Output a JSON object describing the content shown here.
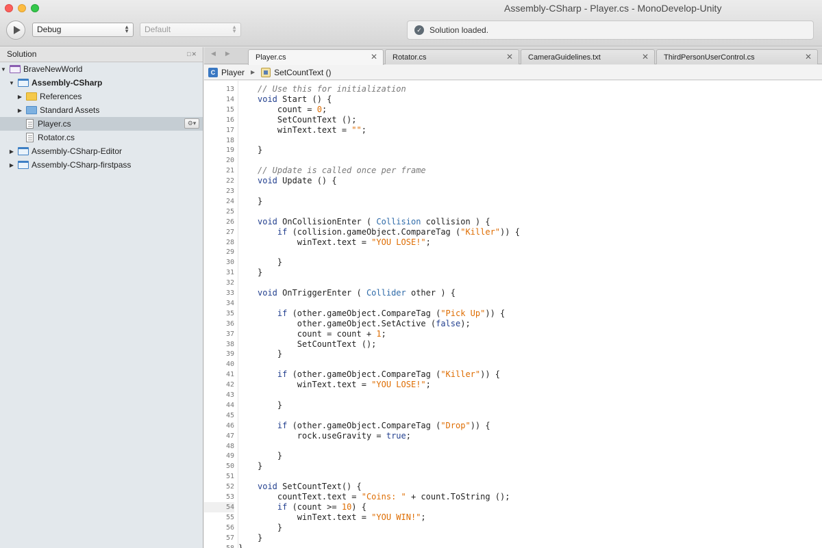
{
  "window": {
    "title": "Assembly-CSharp - Player.cs - MonoDevelop-Unity"
  },
  "toolbar": {
    "config": "Debug",
    "platform": "Default",
    "status": "Solution loaded."
  },
  "solution": {
    "title": "Solution",
    "items": [
      {
        "label": "BraveNewWorld",
        "level": 0,
        "icon": "solution",
        "expanded": true
      },
      {
        "label": "Assembly-CSharp",
        "level": 1,
        "icon": "project",
        "expanded": true,
        "bold": true
      },
      {
        "label": "References",
        "level": 2,
        "icon": "folder",
        "expanded": false
      },
      {
        "label": "Standard Assets",
        "level": 2,
        "icon": "folder-blue",
        "expanded": false
      },
      {
        "label": "Player.cs",
        "level": 2,
        "icon": "file",
        "selected": true
      },
      {
        "label": "Rotator.cs",
        "level": 2,
        "icon": "file"
      },
      {
        "label": "Assembly-CSharp-Editor",
        "level": 1,
        "icon": "project",
        "expanded": false
      },
      {
        "label": "Assembly-CSharp-firstpass",
        "level": 1,
        "icon": "project",
        "expanded": false
      }
    ]
  },
  "tabs": [
    {
      "label": "Player.cs",
      "active": true
    },
    {
      "label": "Rotator.cs"
    },
    {
      "label": "CameraGuidelines.txt"
    },
    {
      "label": "ThirdPersonUserControl.cs"
    }
  ],
  "path": {
    "class": "Player",
    "member": "SetCountText ()"
  },
  "colors": {
    "keyword": "#23408f",
    "type": "#2e6aa8",
    "string": "#de6c00",
    "comment": "#7a7a7a",
    "selection": "#c5cdd3"
  },
  "code": {
    "current_line": 54,
    "lines": [
      {
        "n": 13,
        "t": "// Use this for initialization"
      },
      {
        "n": 14,
        "t": "void Start () {"
      },
      {
        "n": 15,
        "t": "    count = 0;"
      },
      {
        "n": 16,
        "t": "    SetCountText ();"
      },
      {
        "n": 17,
        "t": "    winText.text = \"\";"
      },
      {
        "n": 18,
        "t": ""
      },
      {
        "n": 19,
        "t": "}"
      },
      {
        "n": 20,
        "t": ""
      },
      {
        "n": 21,
        "t": "// Update is called once per frame"
      },
      {
        "n": 22,
        "t": "void Update () {"
      },
      {
        "n": 23,
        "t": ""
      },
      {
        "n": 24,
        "t": "}"
      },
      {
        "n": 25,
        "t": ""
      },
      {
        "n": 26,
        "t": "void OnCollisionEnter ( Collision collision ) {"
      },
      {
        "n": 27,
        "t": "    if (collision.gameObject.CompareTag (\"Killer\")) {"
      },
      {
        "n": 28,
        "t": "        winText.text = \"YOU LOSE!\";"
      },
      {
        "n": 29,
        "t": ""
      },
      {
        "n": 30,
        "t": "    }"
      },
      {
        "n": 31,
        "t": "}"
      },
      {
        "n": 32,
        "t": ""
      },
      {
        "n": 33,
        "t": "void OnTriggerEnter ( Collider other ) {"
      },
      {
        "n": 34,
        "t": ""
      },
      {
        "n": 35,
        "t": "    if (other.gameObject.CompareTag (\"Pick Up\")) {"
      },
      {
        "n": 36,
        "t": "        other.gameObject.SetActive (false);"
      },
      {
        "n": 37,
        "t": "        count = count + 1;"
      },
      {
        "n": 38,
        "t": "        SetCountText ();"
      },
      {
        "n": 39,
        "t": "    }"
      },
      {
        "n": 40,
        "t": ""
      },
      {
        "n": 41,
        "t": "    if (other.gameObject.CompareTag (\"Killer\")) {"
      },
      {
        "n": 42,
        "t": "        winText.text = \"YOU LOSE!\";"
      },
      {
        "n": 43,
        "t": ""
      },
      {
        "n": 44,
        "t": "    }"
      },
      {
        "n": 45,
        "t": ""
      },
      {
        "n": 46,
        "t": "    if (other.gameObject.CompareTag (\"Drop\")) {"
      },
      {
        "n": 47,
        "t": "        rock.useGravity = true;"
      },
      {
        "n": 48,
        "t": ""
      },
      {
        "n": 49,
        "t": "    }"
      },
      {
        "n": 50,
        "t": "}"
      },
      {
        "n": 51,
        "t": ""
      },
      {
        "n": 52,
        "t": "void SetCountText() {"
      },
      {
        "n": 53,
        "t": "    countText.text = \"Coins: \" + count.ToString ();"
      },
      {
        "n": 54,
        "t": "    if (count >= 10) {"
      },
      {
        "n": 55,
        "t": "        winText.text = \"YOU WIN!\";"
      },
      {
        "n": 56,
        "t": "    }"
      },
      {
        "n": 57,
        "t": "}"
      },
      {
        "n": 58,
        "t": "}"
      }
    ]
  }
}
